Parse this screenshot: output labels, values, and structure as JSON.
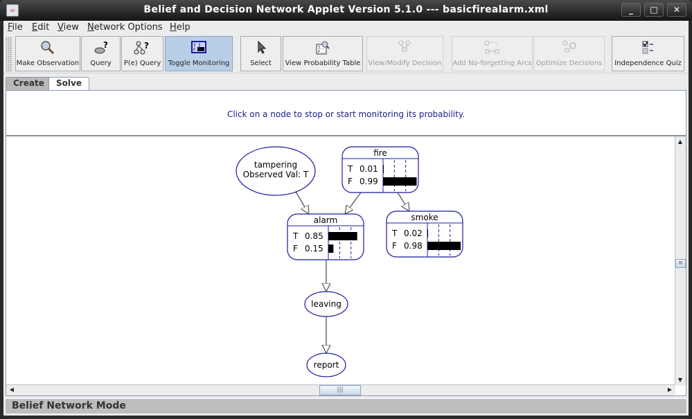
{
  "window": {
    "title": "Belief and Decision Network Applet Version 5.1.0 --- basicfirealarm.xml",
    "controls": {
      "minimize": "_",
      "maximize": "□",
      "close": "✕"
    }
  },
  "menu": {
    "items": [
      {
        "label": "File",
        "mnemonic": "F",
        "rest": "ile"
      },
      {
        "label": "Edit",
        "mnemonic": "E",
        "rest": "dit"
      },
      {
        "label": "View",
        "mnemonic": "V",
        "rest": "iew"
      },
      {
        "label": "Network Options",
        "mnemonic": "N",
        "rest": "etwork Options"
      },
      {
        "label": "Help",
        "mnemonic": "H",
        "rest": "elp"
      }
    ]
  },
  "toolbar": {
    "buttons": [
      {
        "label": "Make Observation",
        "icon": "magnifier-icon",
        "state": "normal"
      },
      {
        "label": "Query",
        "icon": "query-node-icon",
        "state": "normal"
      },
      {
        "label": "P(e) Query",
        "icon": "pe-query-icon",
        "state": "normal"
      },
      {
        "label": "Toggle Monitoring",
        "icon": "monitor-icon",
        "state": "active"
      },
      {
        "label": "Select",
        "icon": "cursor-arrow-icon",
        "state": "normal"
      },
      {
        "label": "View Probability Table",
        "icon": "probability-table-icon",
        "state": "normal"
      },
      {
        "label": "View/Modify Decision",
        "icon": "decision-icon",
        "state": "disabled"
      },
      {
        "label": "Add No-forgetting Arcs",
        "icon": "no-forgetting-arcs-icon",
        "state": "disabled"
      },
      {
        "label": "Optimize Decisions",
        "icon": "optimize-gear-icon",
        "state": "disabled"
      },
      {
        "label": "Independence Quiz",
        "icon": "checklist-icon",
        "state": "normal"
      }
    ]
  },
  "tabs": [
    {
      "label": "Create",
      "selected": false
    },
    {
      "label": "Solve",
      "selected": true
    }
  ],
  "message": "Click on a node to stop or start monitoring its probability.",
  "network": {
    "nodes": {
      "tampering": {
        "name": "tampering",
        "observed": "Observed Val: T"
      },
      "fire": {
        "name": "fire",
        "states": [
          {
            "label": "T",
            "value": "0.01",
            "p": 0.01
          },
          {
            "label": "F",
            "value": "0.99",
            "p": 0.99
          }
        ]
      },
      "alarm": {
        "name": "alarm",
        "states": [
          {
            "label": "T",
            "value": "0.85",
            "p": 0.85
          },
          {
            "label": "F",
            "value": "0.15",
            "p": 0.15
          }
        ]
      },
      "smoke": {
        "name": "smoke",
        "states": [
          {
            "label": "T",
            "value": "0.02",
            "p": 0.02
          },
          {
            "label": "F",
            "value": "0.98",
            "p": 0.98
          }
        ]
      },
      "leaving": {
        "name": "leaving"
      },
      "report": {
        "name": "report"
      }
    },
    "edges": [
      [
        "tampering",
        "alarm"
      ],
      [
        "fire",
        "alarm"
      ],
      [
        "fire",
        "smoke"
      ],
      [
        "alarm",
        "leaving"
      ],
      [
        "leaving",
        "report"
      ]
    ],
    "colors": {
      "node_border": "#1a1aa0",
      "bar": "#000000",
      "edge": "#555555"
    }
  },
  "status": "Belief Network Mode"
}
